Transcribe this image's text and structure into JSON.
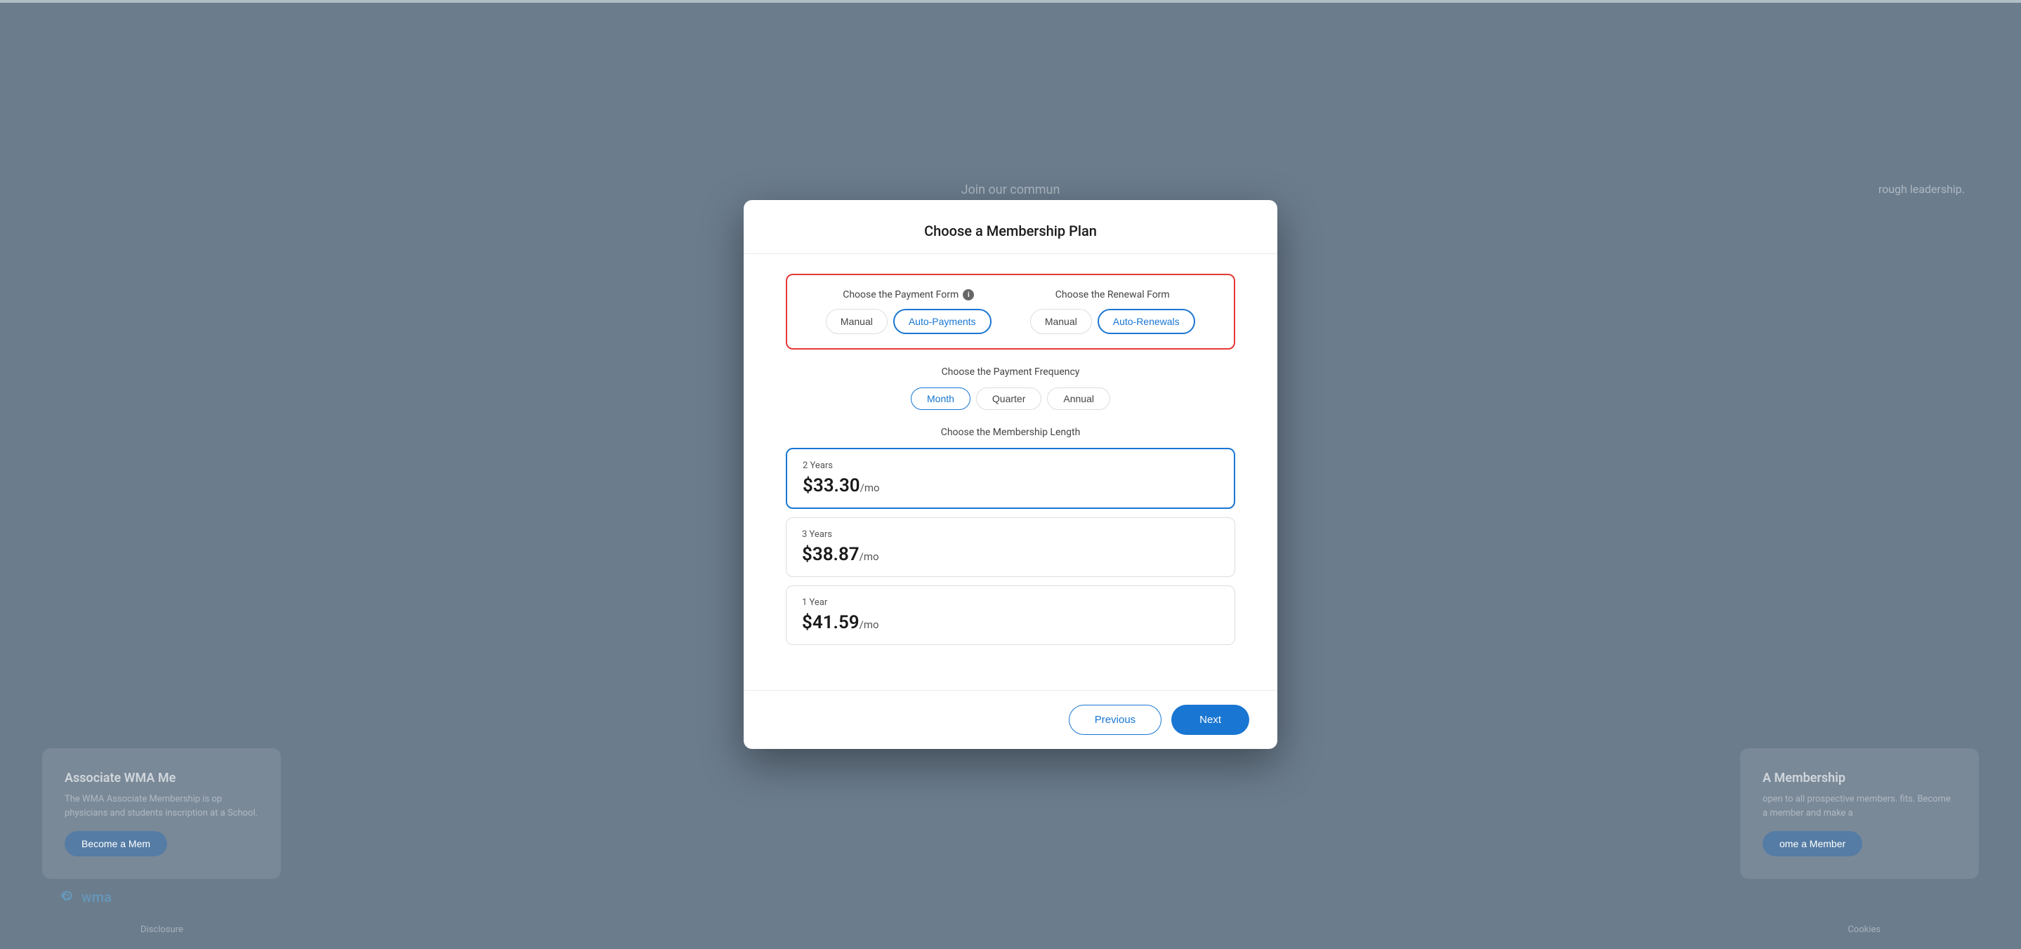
{
  "modal": {
    "title": "Choose a Membership Plan",
    "payment_form": {
      "label": "Choose the Payment Form",
      "info_icon": "ℹ",
      "options": [
        "Manual",
        "Auto-Payments"
      ],
      "selected": "Auto-Payments"
    },
    "renewal_form": {
      "label": "Choose the Renewal Form",
      "options": [
        "Manual",
        "Auto-Renewals"
      ],
      "selected": "Auto-Renewals"
    },
    "frequency": {
      "label": "Choose the Payment Frequency",
      "options": [
        "Month",
        "Quarter",
        "Annual"
      ],
      "selected": "Month"
    },
    "membership_length": {
      "label": "Choose the Membership Length",
      "plans": [
        {
          "id": "2year",
          "years": "2 Years",
          "price": "$33.30",
          "unit": "/mo",
          "selected": true
        },
        {
          "id": "3year",
          "years": "3 Years",
          "price": "$38.87",
          "unit": "/mo",
          "selected": false
        },
        {
          "id": "1year",
          "years": "1 Year",
          "price": "$41.59",
          "unit": "/mo",
          "selected": false
        }
      ]
    },
    "footer": {
      "previous_label": "Previous",
      "next_label": "Next"
    }
  },
  "background": {
    "join_text": "Join our commun",
    "leadership_text": "rough leadership.",
    "left_card": {
      "title": "Associate WMA Me",
      "description": "The WMA Associate Membership is op physicians and students inscription at a School.",
      "button": "Become a Mem"
    },
    "right_card": {
      "title": "A Membership",
      "description": "open to all prospective members. fits. Become a member and make a",
      "button": "ome a Member"
    },
    "wma_label": "wma",
    "disclosure": "Disclosure",
    "cookies": "Cookies"
  }
}
